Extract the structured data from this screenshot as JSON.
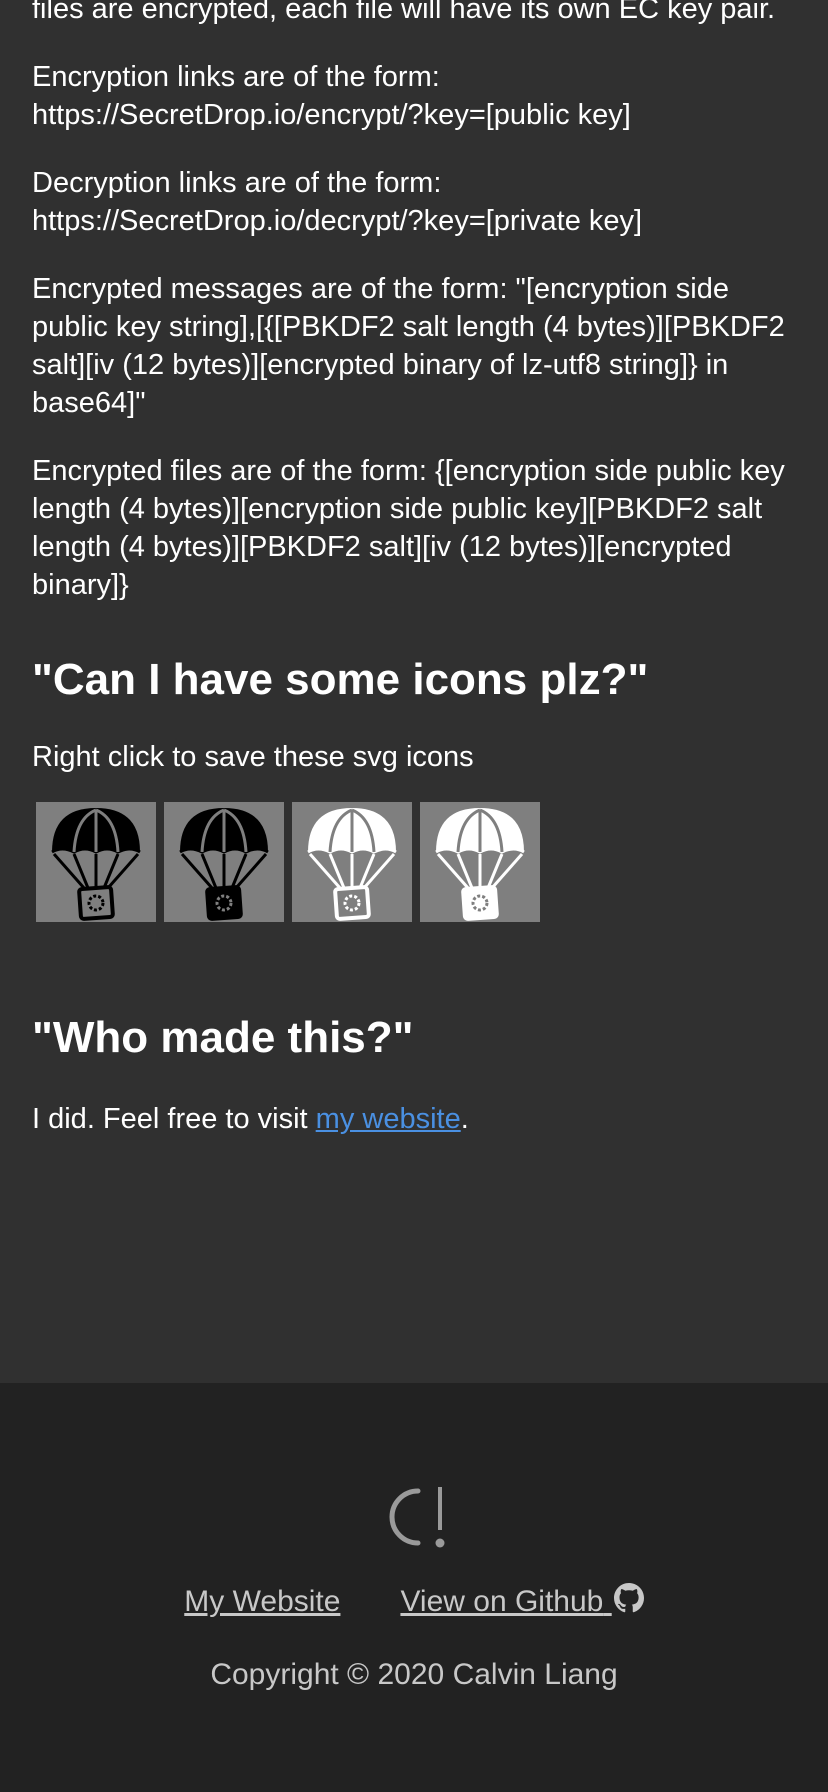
{
  "intro": {
    "lead": "files are encrypted, each file will have its own EC key pair.",
    "encrypt_links": "Encryption links are of the form: https://SecretDrop.io/encrypt/?key=[public key]",
    "decrypt_links": "Decryption links are of the form: https://SecretDrop.io/decrypt/?key=[private key]",
    "messages": "Encrypted messages are of the form: \"[encryption side public key string],[{[PBKDF2 salt length (4 bytes)][PBKDF2 salt][iv (12 bytes)][encrypted binary of lz-utf8 string]} in base64]\"",
    "files": "Encrypted files are of the form: {[encryption side public key length (4 bytes)][encryption side public key][PBKDF2 salt length (4 bytes)][PBKDF2 salt][iv (12 bytes)][encrypted binary]}"
  },
  "icons_section": {
    "heading": "\"Can I have some icons plz?\"",
    "text": "Right click to save these svg icons",
    "icons": [
      {
        "name": "parachute-outline-dark-icon",
        "canopy": "#000000",
        "box": "#000000",
        "style": "outline"
      },
      {
        "name": "parachute-filled-dark-icon",
        "canopy": "#000000",
        "box": "#000000",
        "style": "filled"
      },
      {
        "name": "parachute-outline-light-icon",
        "canopy": "#ffffff",
        "box": "#ffffff",
        "style": "outline"
      },
      {
        "name": "parachute-filled-light-icon",
        "canopy": "#ffffff",
        "box": "#ffffff",
        "style": "filled"
      }
    ]
  },
  "about_section": {
    "heading": "\"Who made this?\"",
    "text_before": "I did. Feel free to visit ",
    "link_label": "my website",
    "text_after": "."
  },
  "footer": {
    "logo_icon": "logo-icon",
    "my_website_label": "My Website",
    "github_label": "View on Github",
    "github_icon": "github-icon",
    "copyright": "Copyright © 2020 Calvin Liang"
  },
  "colors": {
    "main_bg": "#303030",
    "footer_bg": "#222222",
    "link": "#4a90e2",
    "footer_text": "#c8c8c8",
    "icon_tile_bg": "#7f7f7f"
  }
}
